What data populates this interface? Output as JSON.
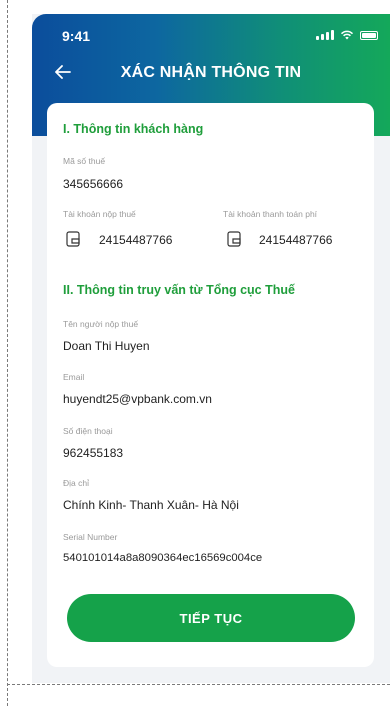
{
  "status_bar": {
    "time": "9:41"
  },
  "header": {
    "title": "XÁC NHẬN THÔNG TIN"
  },
  "section1": {
    "title": "I. Thông tin khách hàng",
    "tax_code_label": "Mã số thuế",
    "tax_code_value": "345656666",
    "tax_account_label": "Tài khoản nộp thuế",
    "tax_account_value": "24154487766",
    "fee_account_label": "Tài khoản thanh toán phí",
    "fee_account_value": "24154487766"
  },
  "section2": {
    "title": "II. Thông tin truy vấn từ Tổng cục Thuế",
    "taxpayer_label": "Tên người nộp thuế",
    "taxpayer_value": "Doan Thi Huyen",
    "email_label": "Email",
    "email_value": "huyendt25@vpbank.com.vn",
    "phone_label": "Số điện thoại",
    "phone_value": "962455183",
    "address_label": "Địa chỉ",
    "address_value": "Chính Kinh- Thanh Xuân- Hà Nội",
    "serial_label": "Serial Number",
    "serial_value": "540101014a8a8090364ec16569c004ce"
  },
  "actions": {
    "continue_label": "TIẾP TỤC"
  },
  "colors": {
    "accent_green": "#15a24a",
    "header_blue": "#0b4d9c",
    "section_green": "#1f9e3b"
  },
  "icons": [
    "back-arrow-icon",
    "signal-icon",
    "wifi-icon",
    "battery-icon",
    "wallet-icon"
  ]
}
